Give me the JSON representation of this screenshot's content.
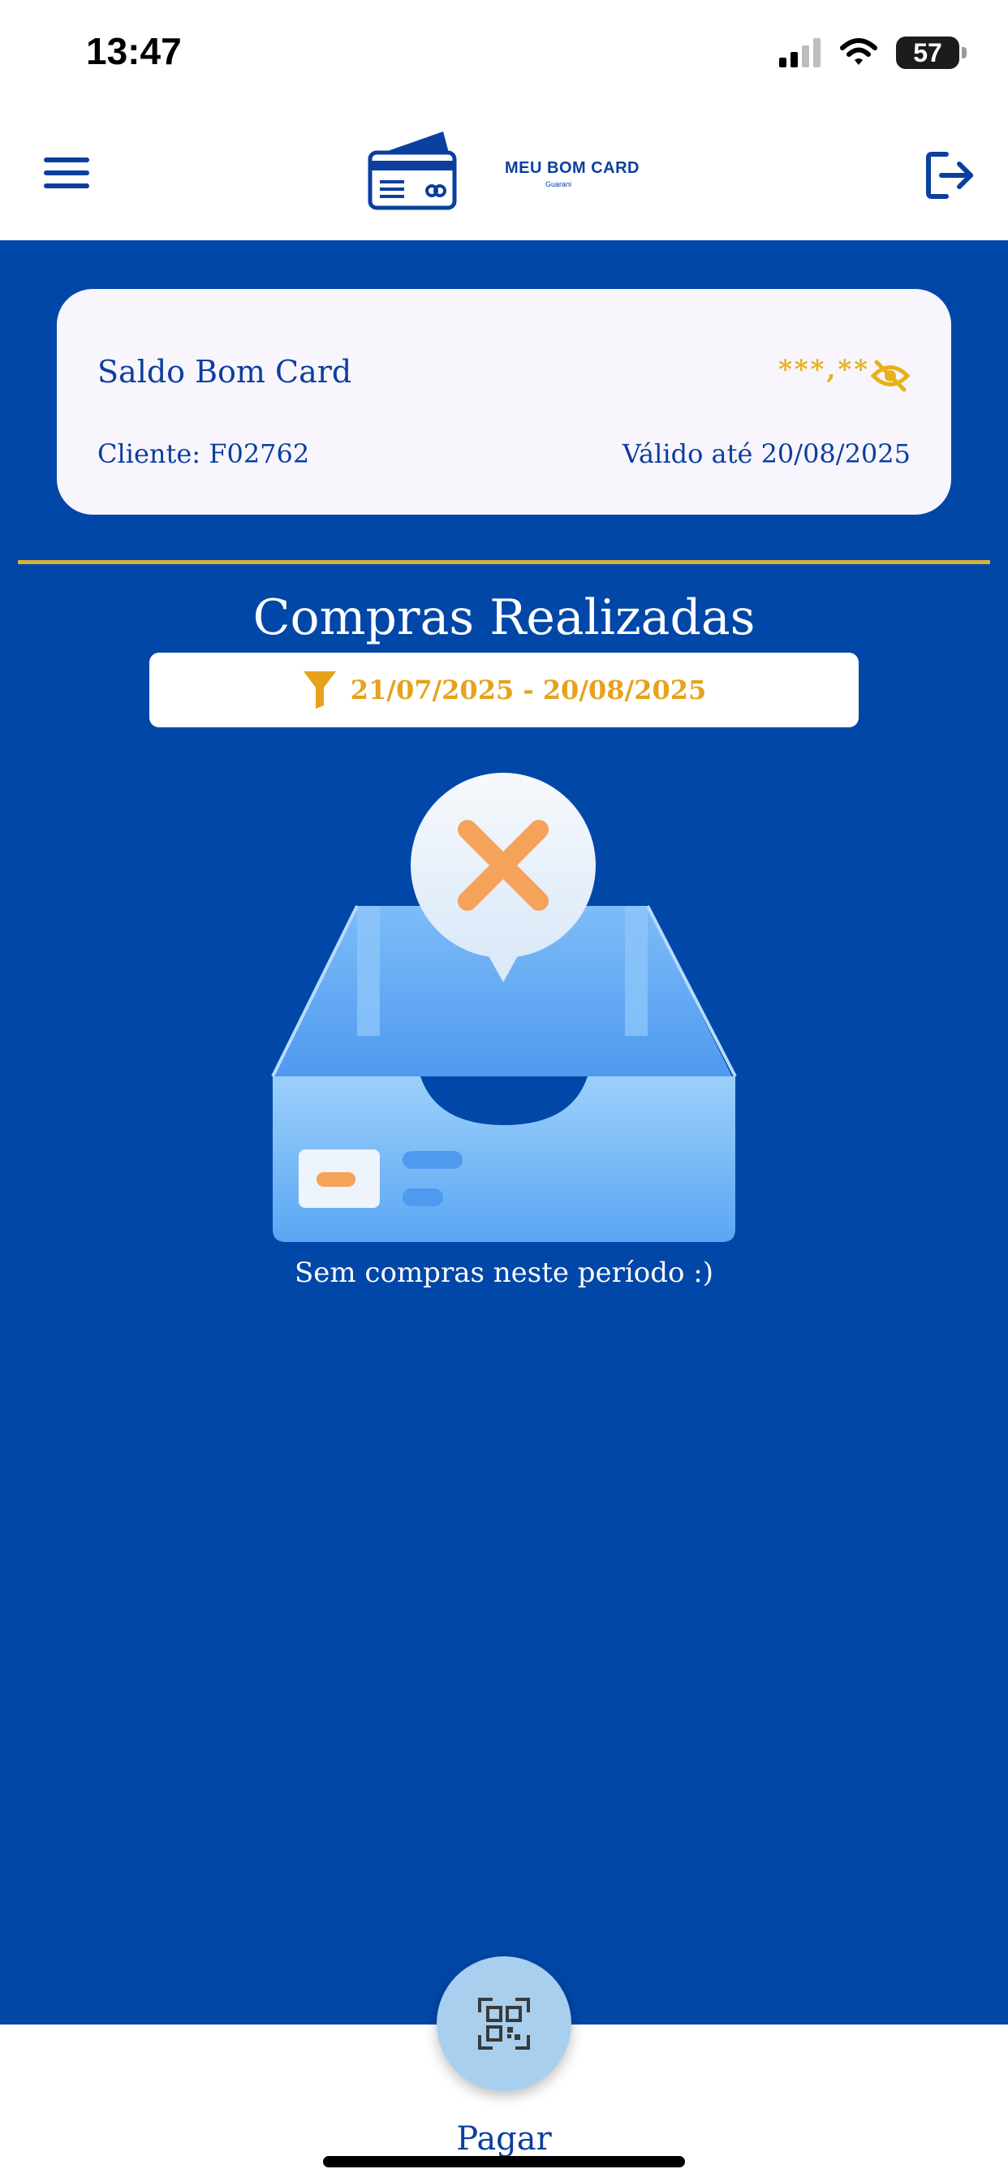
{
  "status_bar": {
    "time": "13:47",
    "battery": "57"
  },
  "header": {
    "brand_name": "MEU BOM CARD",
    "brand_sub": "Guarani"
  },
  "balance_card": {
    "title": "Saldo Bom Card",
    "masked_value": "***,**",
    "client_label": "Cliente: F02762",
    "valid_until": "Válido até 20/08/2025"
  },
  "purchases": {
    "title": "Compras Realizadas",
    "date_range": "21/07/2025 - 20/08/2025",
    "empty_message": "Sem compras neste período :)"
  },
  "bottom_nav": {
    "pay_label": "Pagar"
  },
  "colors": {
    "primary": "#0047a8",
    "accent": "#e6b119",
    "card_bg": "#f8f5fc"
  }
}
